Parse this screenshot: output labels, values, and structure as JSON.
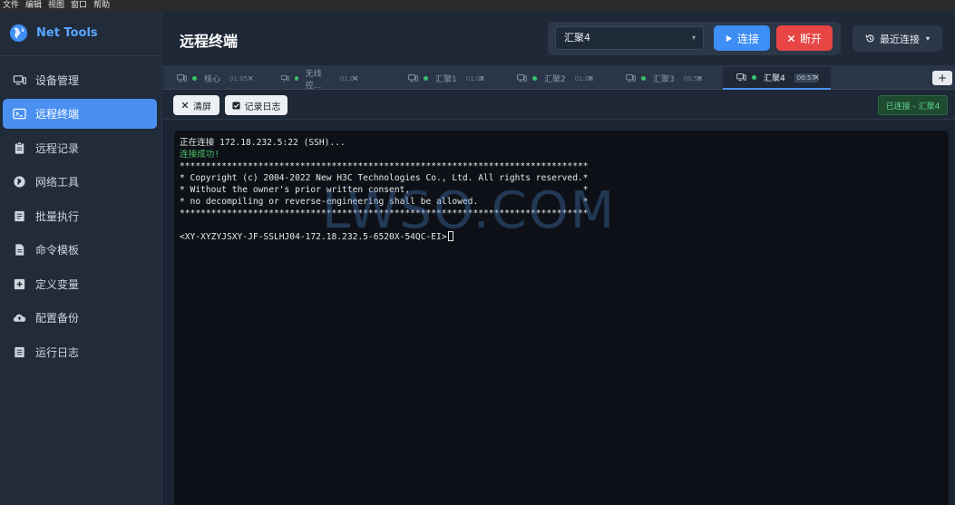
{
  "menubar": [
    "文件",
    "编辑",
    "视图",
    "窗口",
    "帮助"
  ],
  "brand": {
    "name": "Net Tools"
  },
  "sidebar": {
    "items": [
      {
        "label": "设备管理",
        "icon": "monitor-icon"
      },
      {
        "label": "远程终端",
        "icon": "terminal-icon",
        "active": true
      },
      {
        "label": "远程记录",
        "icon": "clipboard-icon"
      },
      {
        "label": "网络工具",
        "icon": "globe-icon"
      },
      {
        "label": "批量执行",
        "icon": "list-icon"
      },
      {
        "label": "命令模板",
        "icon": "file-icon"
      },
      {
        "label": "定义变量",
        "icon": "plus-square-icon"
      },
      {
        "label": "配置备份",
        "icon": "cloud-upload-icon"
      },
      {
        "label": "运行日志",
        "icon": "log-icon"
      }
    ]
  },
  "header": {
    "title": "远程终端",
    "selected_host": "汇聚4",
    "connect_label": "连接",
    "disconnect_label": "断开",
    "recent_label": "最近连接"
  },
  "tabs": [
    {
      "label": "核心",
      "time": "01:05"
    },
    {
      "label": "无线控...",
      "time": "01:04"
    },
    {
      "label": "汇聚1",
      "time": "01:02"
    },
    {
      "label": "汇聚2",
      "time": "01:00"
    },
    {
      "label": "汇聚3",
      "time": "00:59"
    },
    {
      "label": "汇聚4",
      "time": "00:57",
      "active": true
    }
  ],
  "toolbar": {
    "clear_label": "清屏",
    "log_label": "记录日志",
    "status": "已连接 - 汇聚4"
  },
  "terminal": {
    "lines": [
      "正在连接 172.18.232.5:22 (SSH)...",
      "连接成功!",
      "******************************************************************************",
      "* Copyright (c) 2004-2022 New H3C Technologies Co., Ltd. All rights reserved.*",
      "* Without the owner's prior written consent,                                 *",
      "* no decompiling or reverse-engineering shall be allowed.                    *",
      "******************************************************************************",
      "",
      "<XY-XYZYJSXY-JF-SSLHJ04-172.18.232.5-6520X-54QC-EI>"
    ]
  },
  "watermark": "LWSO.COM",
  "colors": {
    "accent": "#4a90f0",
    "danger": "#e84545",
    "success": "#37c46b",
    "terminal_bg": "#0d1117"
  }
}
